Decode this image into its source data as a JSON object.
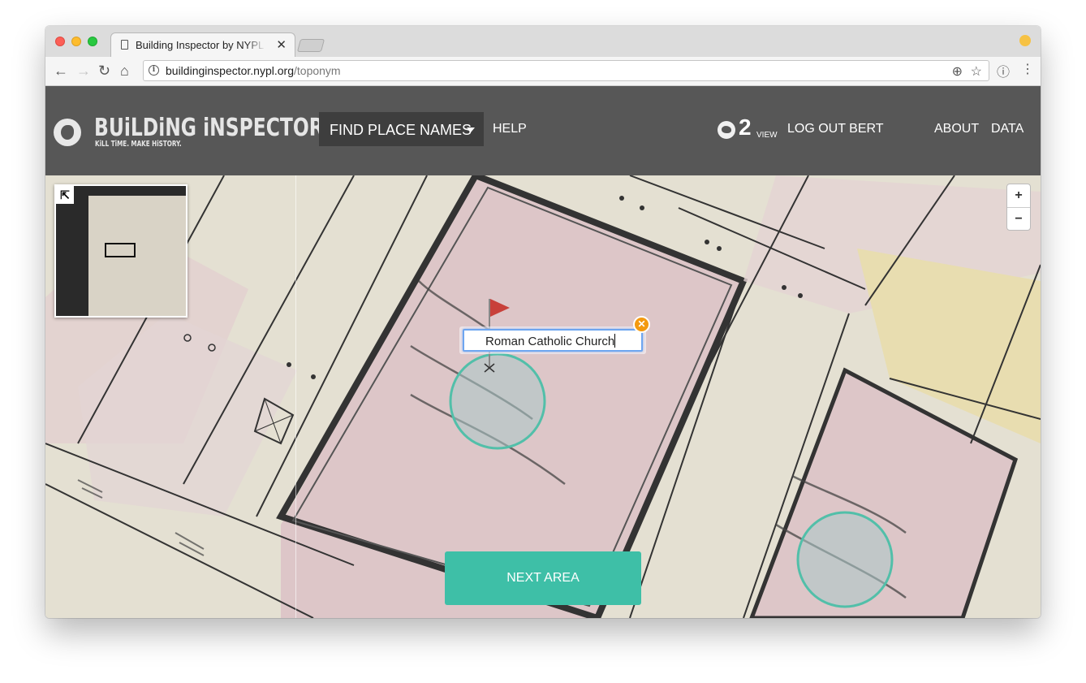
{
  "browser": {
    "tab_title": "Building Inspector by NYPL Labs",
    "tab_close": "✕",
    "url_host": "buildinginspector.nypl.org",
    "url_path": "/toponym"
  },
  "header": {
    "brand": "BUiLDiNG iNSPECTOR",
    "tagline": "KiLL TiME. MAKE HiSTORY.",
    "mode_label": "FIND PLACE NAMES",
    "help": "HELP",
    "tweet_count": "2",
    "view": "VIEW",
    "logout": "LOG OUT BERT",
    "about": "ABOUT",
    "data": "DATA"
  },
  "map": {
    "zoom_in": "+",
    "zoom_out": "−",
    "toponym_value": "Roman Catholic Church",
    "next_button": "NEXT AREA",
    "minimap_toggle": "⇱"
  },
  "colors": {
    "header_bg": "#575757",
    "accent_teal": "#3ebfa7",
    "close_orange": "#f39a11",
    "flag_red": "#c8403a"
  }
}
